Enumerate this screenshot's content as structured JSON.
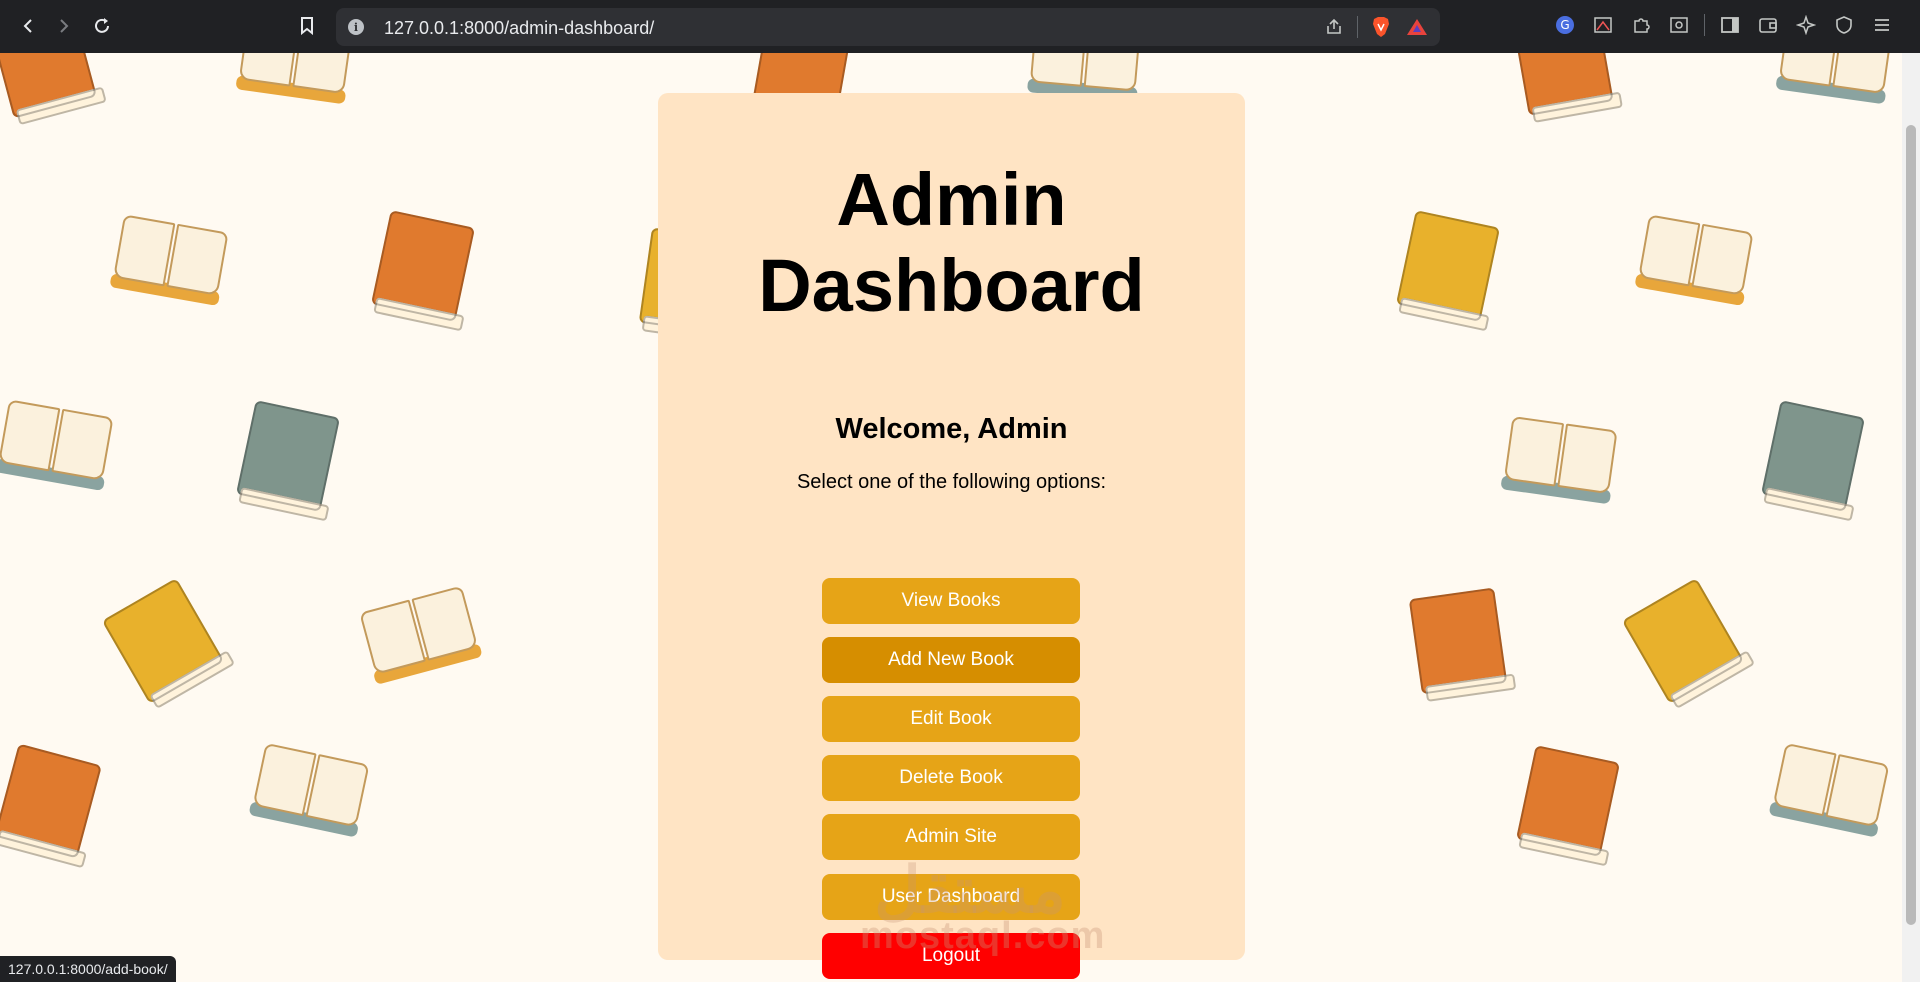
{
  "browser": {
    "url": "127.0.0.1:8000/admin-dashboard/",
    "status_url": "127.0.0.1:8000/add-book/"
  },
  "dashboard": {
    "title_line1": "Admin",
    "title_line2": "Dashboard",
    "welcome": "Welcome, Admin",
    "subtitle": "Select one of the following options:",
    "buttons": [
      {
        "label": "View Books"
      },
      {
        "label": "Add New Book"
      },
      {
        "label": "Edit Book"
      },
      {
        "label": "Delete Book"
      },
      {
        "label": "Admin Site"
      },
      {
        "label": "User Dashboard"
      },
      {
        "label": "Logout"
      }
    ]
  },
  "watermark": {
    "latin": "mostaql.com",
    "arabic": "مستقل"
  },
  "colors": {
    "card_bg": "#ffe4c4",
    "button": "#e6a417",
    "button_hover": "#d68e00",
    "logout": "#ff0000",
    "page_bg": "#fffaf2"
  }
}
